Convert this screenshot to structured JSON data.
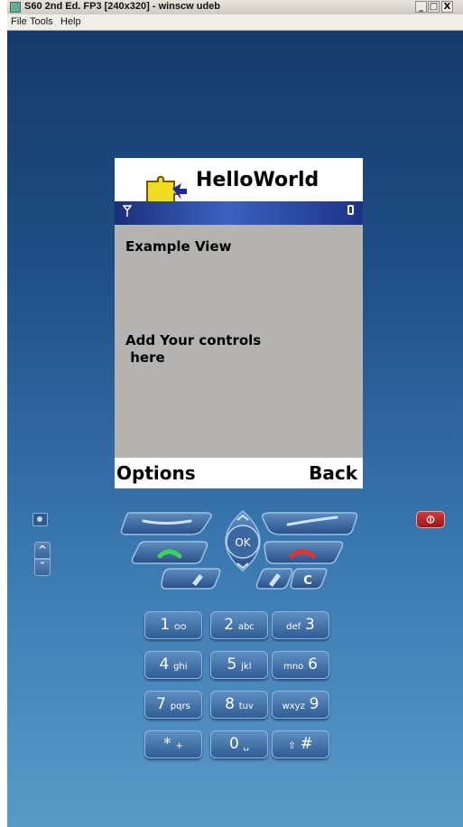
{
  "window": {
    "title": "S60 2nd Ed. FP3  [240x320] - winscw udeb",
    "controls": {
      "minimize": "_",
      "maximize": "□",
      "close": "X"
    }
  },
  "menubar": {
    "items": [
      "File",
      "Tools",
      "Help"
    ]
  },
  "phone": {
    "screen": {
      "app_title": "HelloWorld",
      "app_icon": "puzzle-piece-icon",
      "view_title": "Example View",
      "body_text": "Add Your controls\n here",
      "softkeys": {
        "left": "Options",
        "right": "Back"
      }
    },
    "side_keys": {
      "power_label": "⏼"
    },
    "navigation": {
      "ok_label": "OK",
      "clear_label": "C"
    },
    "keypad": [
      {
        "digit": "1",
        "letters": "ᴑᴑ"
      },
      {
        "digit": "2",
        "letters": "abc"
      },
      {
        "digit": "3",
        "letters": "def"
      },
      {
        "digit": "4",
        "letters": "ghi"
      },
      {
        "digit": "5",
        "letters": "jkl"
      },
      {
        "digit": "6",
        "letters": "mno"
      },
      {
        "digit": "7",
        "letters": "pqrs"
      },
      {
        "digit": "8",
        "letters": "tuv"
      },
      {
        "digit": "9",
        "letters": "wxyz"
      },
      {
        "digit": "*",
        "letters": "+"
      },
      {
        "digit": "0",
        "letters": "␣"
      },
      {
        "digit": "#",
        "letters": "⇧"
      }
    ]
  }
}
